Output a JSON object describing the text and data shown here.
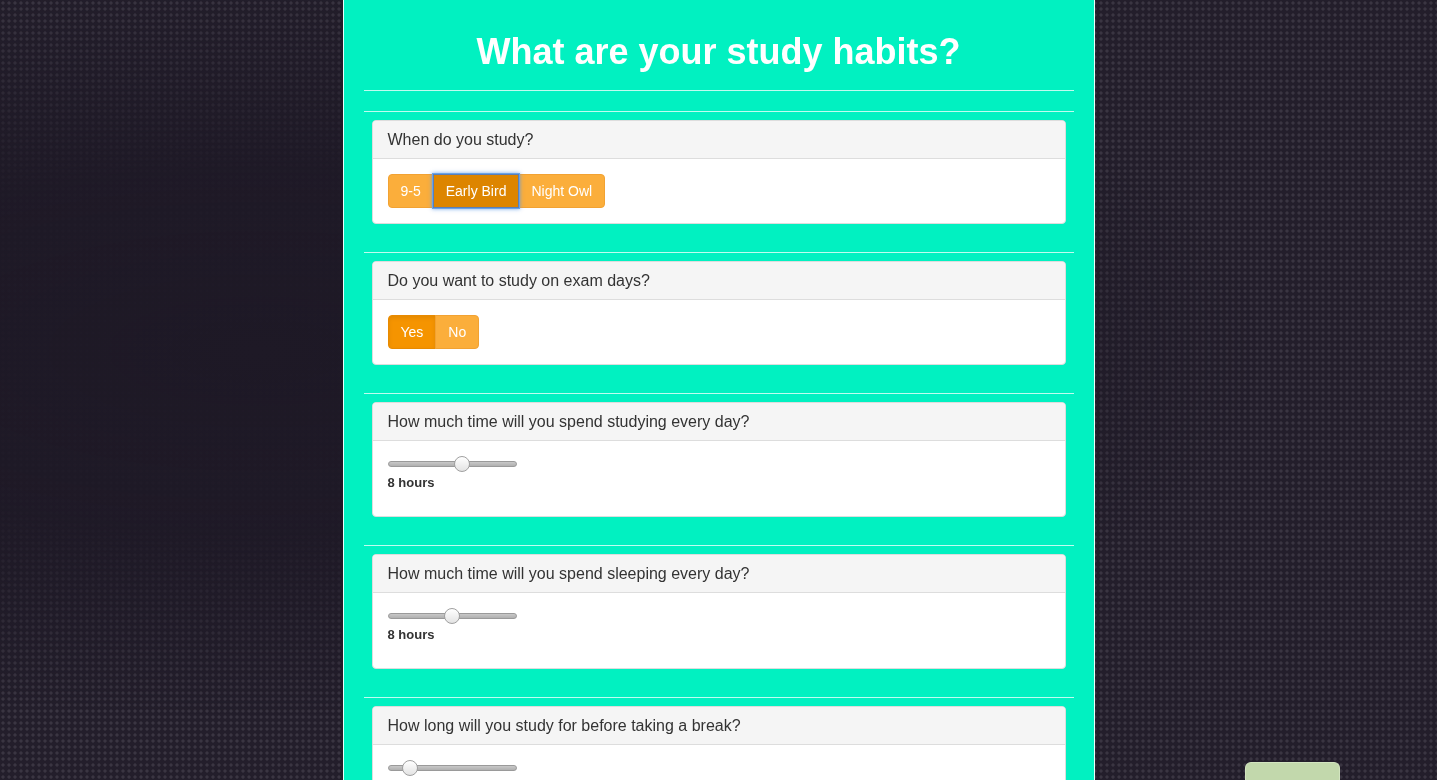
{
  "title": "What are your study habits?",
  "questions": [
    {
      "kind": "choice",
      "prompt": "When do you study?",
      "options": [
        {
          "label": "9-5",
          "selected": false,
          "focused": false
        },
        {
          "label": "Early Bird",
          "selected": true,
          "focused": true
        },
        {
          "label": "Night Owl",
          "selected": false,
          "focused": false
        }
      ]
    },
    {
      "kind": "choice",
      "prompt": "Do you want to study on exam days?",
      "options": [
        {
          "label": "Yes",
          "selected": true,
          "focused": false
        },
        {
          "label": "No",
          "selected": false,
          "focused": false
        }
      ]
    },
    {
      "kind": "slider",
      "prompt": "How much time will you spend studying every day?",
      "level": 0.59,
      "reading": "8 hours"
    },
    {
      "kind": "slider",
      "prompt": "How much time will you spend sleeping every day?",
      "level": 0.5,
      "reading": "8 hours"
    },
    {
      "kind": "slider",
      "prompt": "How long will you study for before taking a break?",
      "level": 0.13
    }
  ]
}
